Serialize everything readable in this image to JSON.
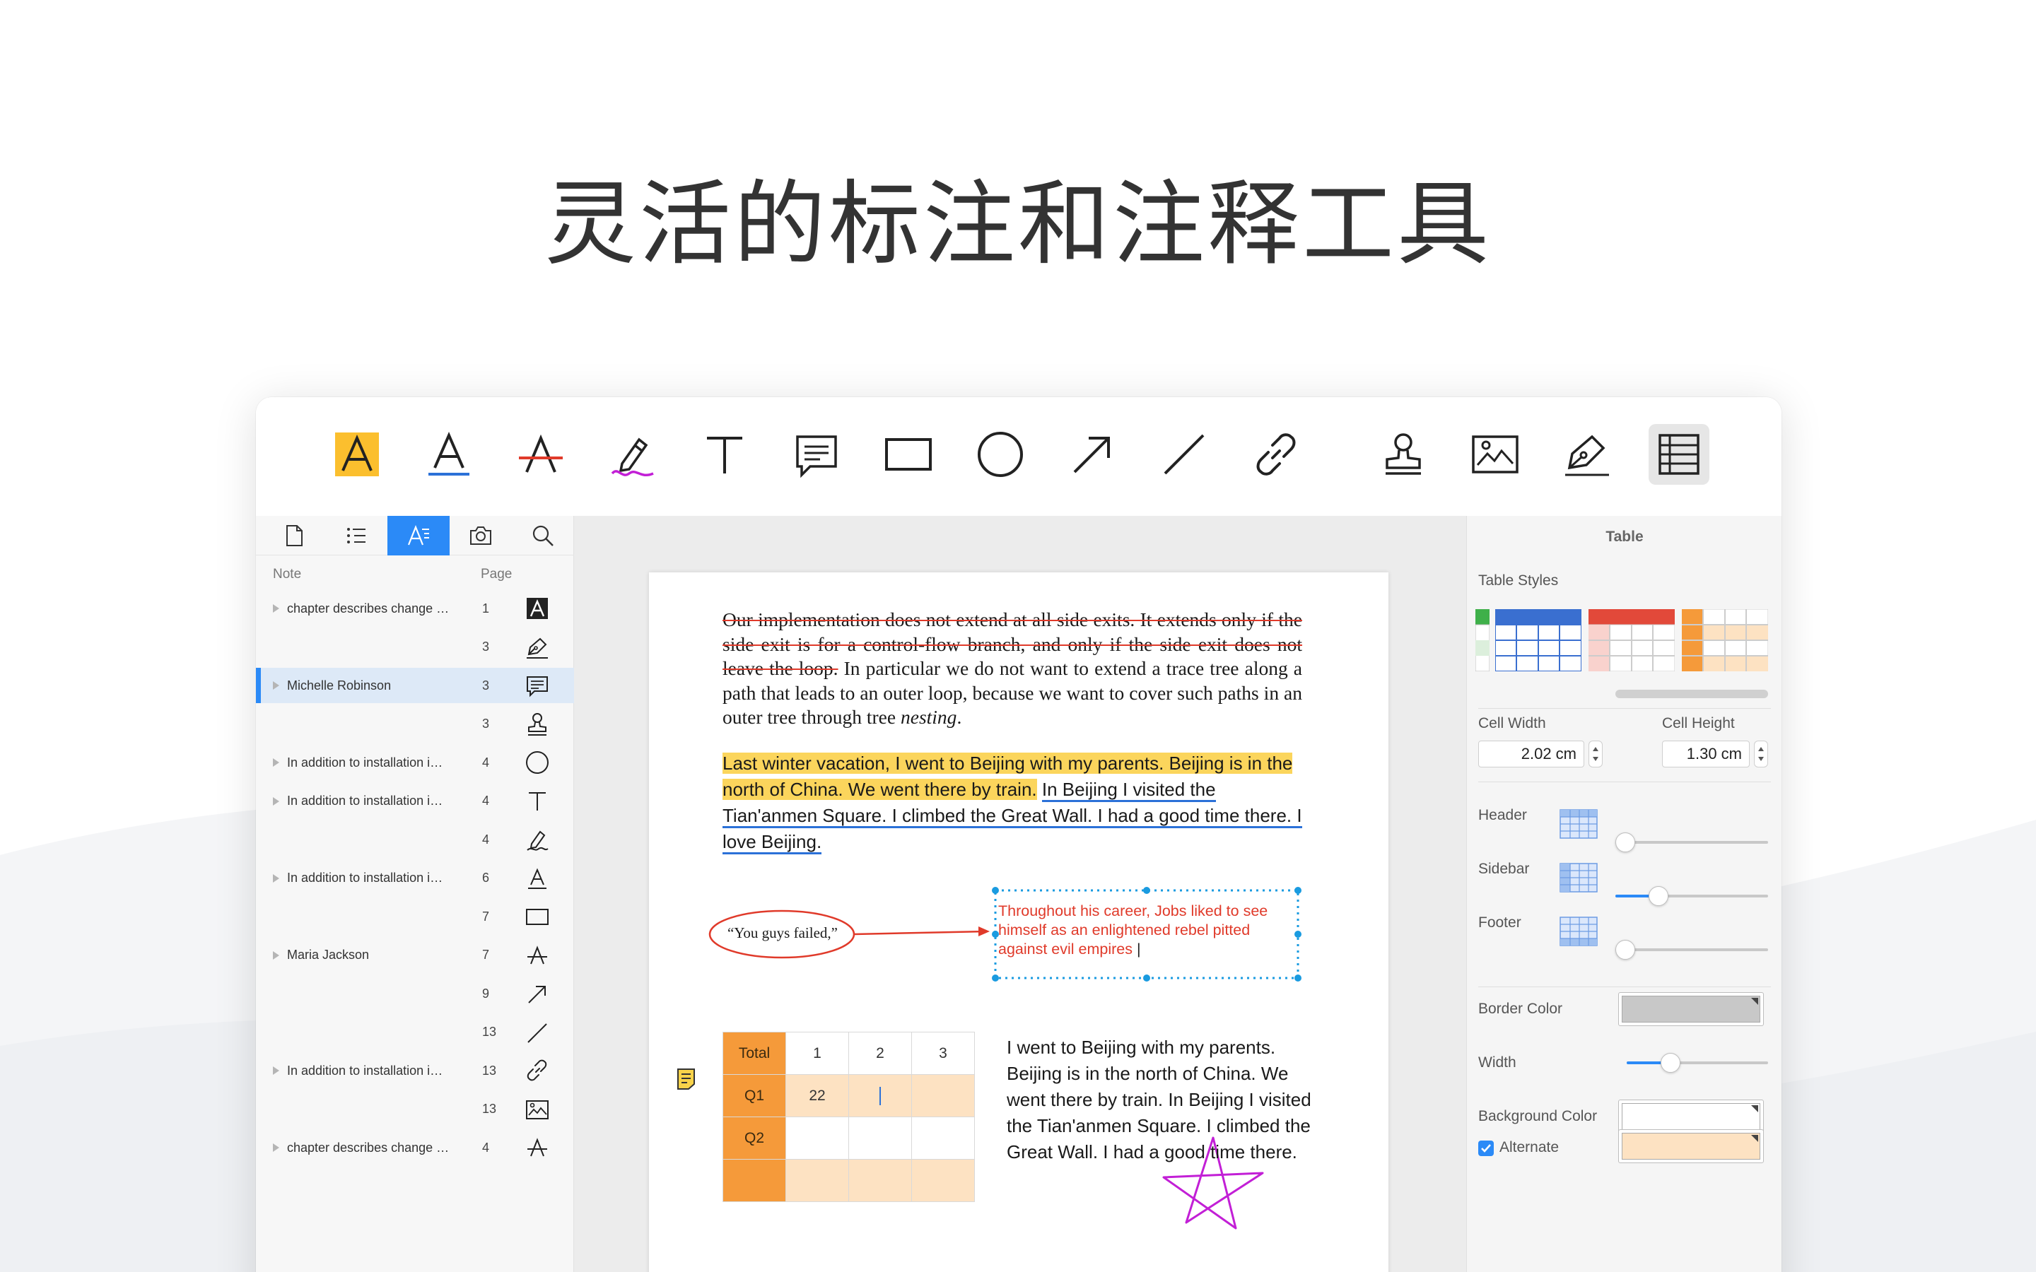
{
  "headline": "灵活的标注和注释工具",
  "colors": {
    "accent": "#2b8af7",
    "highlight": "#fbd55c",
    "strike": "#e03a2a",
    "underline": "#2b71d8",
    "table_header": "#f59a3a",
    "table_alt": "#fde2c2",
    "freehand": "#c21fd6"
  },
  "toolbar": {
    "tools": [
      "highlight-icon",
      "underline-icon",
      "strikethrough-icon",
      "freehand-icon",
      "text-icon",
      "note-icon",
      "rectangle-icon",
      "oval-icon",
      "arrow-icon",
      "line-icon",
      "link-icon",
      "stamp-icon",
      "image-icon",
      "signature-icon",
      "table-icon"
    ],
    "active_tool": "table-icon"
  },
  "sidebar": {
    "tabs": [
      "thumbnails-icon",
      "outline-icon",
      "annotations-icon",
      "snapshot-icon",
      "search-icon"
    ],
    "active_tab": "annotations-icon",
    "col_note": "Note",
    "col_page": "Page",
    "notes": [
      {
        "text": "chapter describes change Sho...",
        "page": "1",
        "icon": "highlight-icon",
        "expandable": true
      },
      {
        "text": "",
        "page": "3",
        "icon": "signature-icon",
        "expandable": false
      },
      {
        "text": "Michelle Robinson",
        "page": "3",
        "icon": "note-icon",
        "expandable": true,
        "selected": true
      },
      {
        "text": "",
        "page": "3",
        "icon": "stamp-icon",
        "expandable": false
      },
      {
        "text": "In addition to installation instru...",
        "page": "4",
        "icon": "oval-icon",
        "expandable": true
      },
      {
        "text": "In addition to installation instru...",
        "page": "4",
        "icon": "text-icon",
        "expandable": true
      },
      {
        "text": "",
        "page": "4",
        "icon": "freehand-icon",
        "expandable": false
      },
      {
        "text": "In addition to installation instru...",
        "page": "6",
        "icon": "underline-icon",
        "expandable": true
      },
      {
        "text": "",
        "page": "7",
        "icon": "rectangle-icon",
        "expandable": false
      },
      {
        "text": "Maria Jackson",
        "page": "7",
        "icon": "strikethrough-icon",
        "expandable": true
      },
      {
        "text": "",
        "page": "9",
        "icon": "arrow-icon",
        "expandable": false
      },
      {
        "text": "",
        "page": "13",
        "icon": "line-icon",
        "expandable": false
      },
      {
        "text": "In addition to installation instru...",
        "page": "13",
        "icon": "link-icon",
        "expandable": true
      },
      {
        "text": "",
        "page": "13",
        "icon": "image-icon",
        "expandable": false
      },
      {
        "text": "chapter describes change Sho...",
        "page": "4",
        "icon": "strikethrough-icon",
        "expandable": true
      }
    ]
  },
  "document": {
    "para1_struck": "Our implementation does not extend at all side exits. It extends only if the side exit is for a control-flow branch, and only if the side exit does not leave the loop.",
    "para1_rest": " In particular we do not want to extend a trace tree along a path that leads to an outer loop, because we want to cover such paths in an outer tree through tree ",
    "para1_italic": "nesting",
    "para1_end": ".",
    "para2_highlight": "Last winter vacation, I went to Beijing with my parents. Beijing is in the north of China. We went there by train.",
    "para2_underline": "In Beijing I visited the Tian'anmen Square. I climbed the Great Wall. I had a good time there. I love Beijing.",
    "oval_quote": "“You guys failed,”",
    "callout": "Throughout his career, Jobs liked to see himself as an enlightened rebel pitted against evil empires",
    "table": {
      "header": [
        "Total",
        "1",
        "2",
        "3"
      ],
      "rows": [
        [
          "Q1",
          "22",
          "",
          ""
        ],
        [
          "Q2",
          "",
          "",
          ""
        ],
        [
          "",
          "",
          "",
          ""
        ]
      ]
    },
    "para3": "I went to Beijing with my parents. Beijing is in the north of China. We went there by train. In Beijing I visited the Tian'anmen Square. I climbed the Great Wall. I had a good time there."
  },
  "inspector": {
    "title": "Table",
    "table_styles_label": "Table Styles",
    "cell_width_label": "Cell Width",
    "cell_width_value": "2.02 cm",
    "cell_height_label": "Cell Height",
    "cell_height_value": "1.30 cm",
    "header_label": "Header",
    "header_level": 0.0,
    "sidebar_label": "Sidebar",
    "sidebar_level": 0.25,
    "footer_label": "Footer",
    "footer_level": 0.0,
    "border_color_label": "Border Color",
    "border_color": "#c8c8c8",
    "width_label": "Width",
    "width_level": 0.28,
    "background_color_label": "Background Color",
    "background_color": "#ffffff",
    "alternate_label": "Alternate",
    "alternate_checked": true,
    "alternate_color": "#fde2c2",
    "styles": [
      "#3a6fd0",
      "#e2493a",
      "#f59a3a"
    ]
  }
}
